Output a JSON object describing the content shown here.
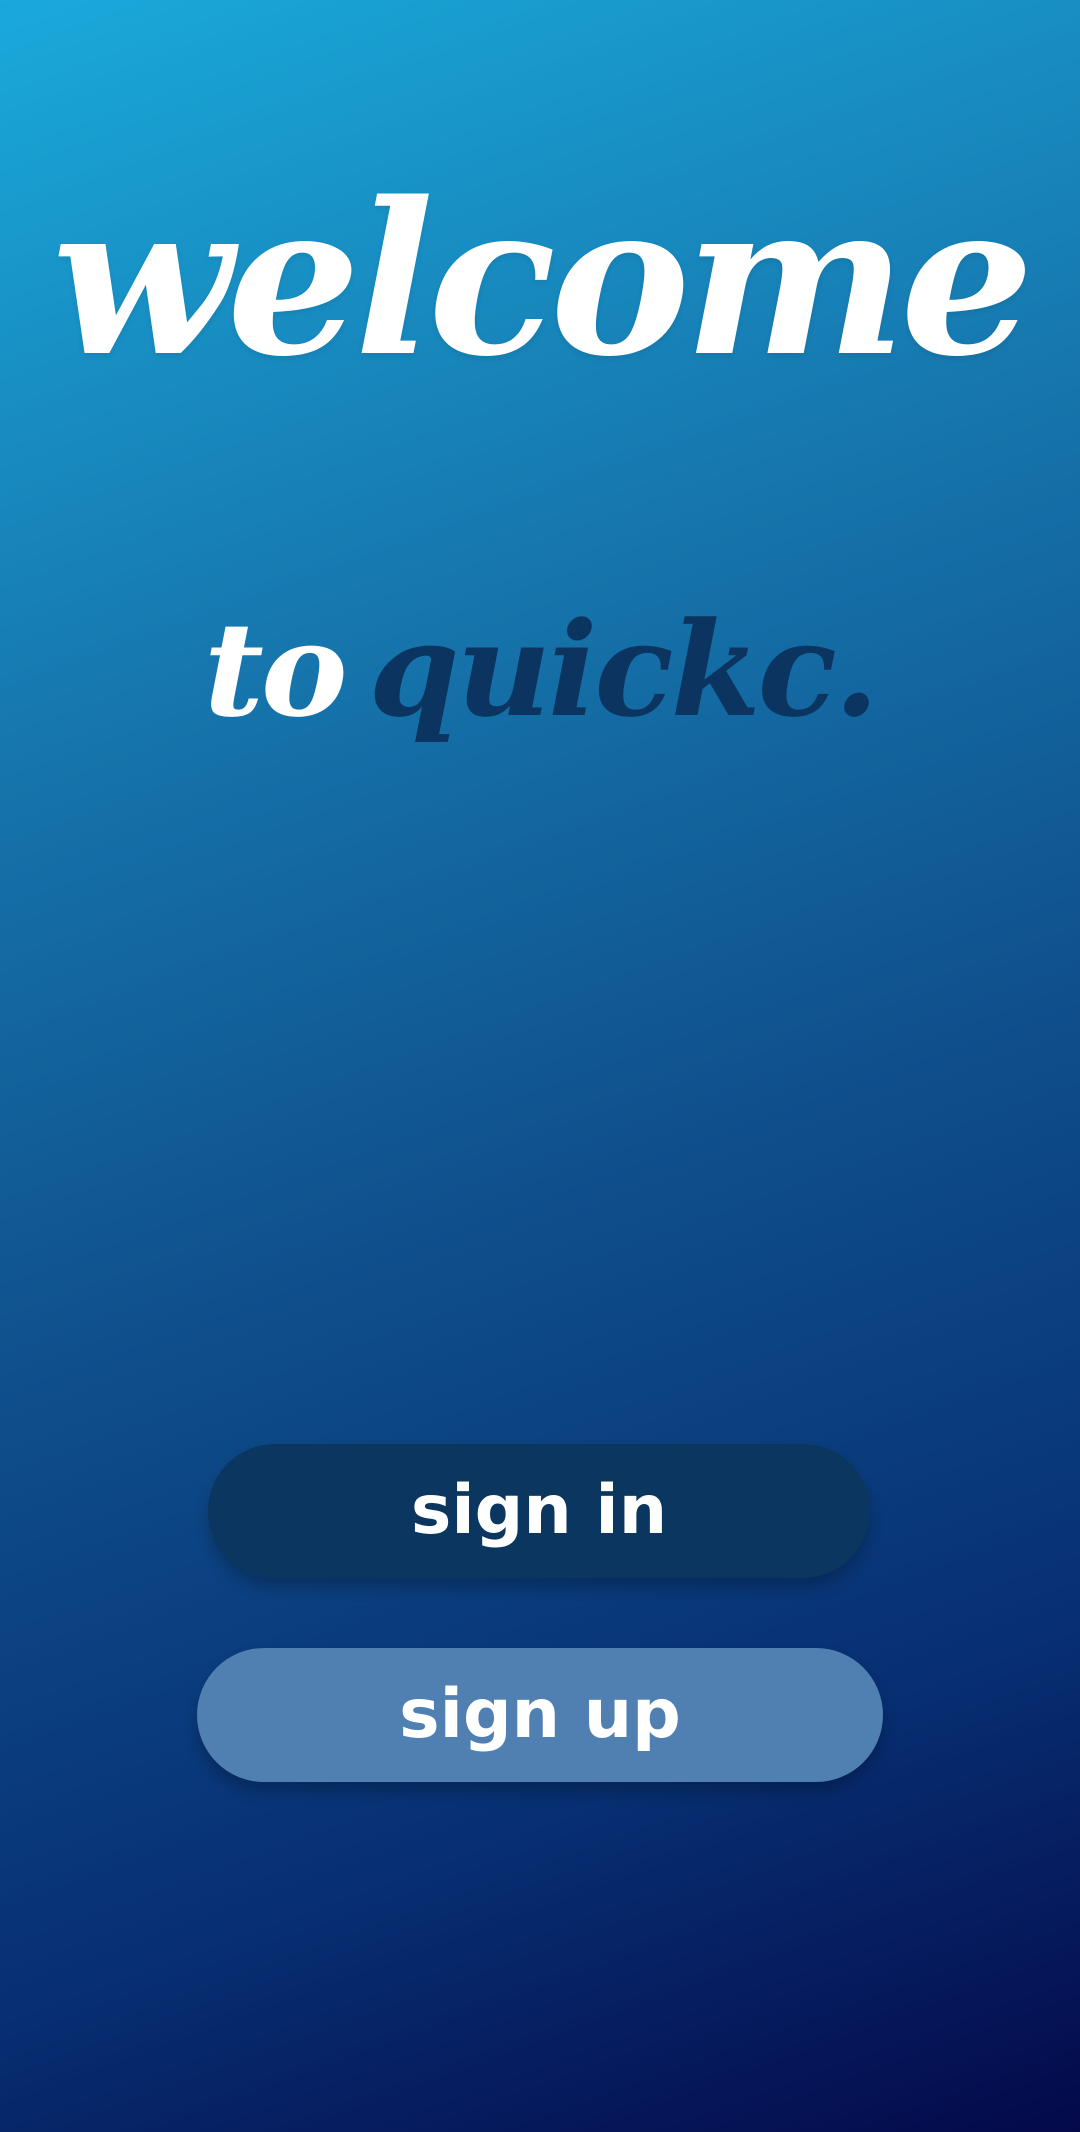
{
  "welcome": {
    "title": "welcome",
    "to_text": "to",
    "brand_name": "quickc."
  },
  "actions": {
    "sign_in_label": "sign in",
    "sign_up_label": "sign up"
  },
  "colors": {
    "background_top": "#1aa9db",
    "background_bottom": "#04094a",
    "brand_text": "#0b3560",
    "sign_in_button": "#0b365f",
    "sign_up_button": "#4f80b1",
    "text_light": "#ffffff"
  }
}
